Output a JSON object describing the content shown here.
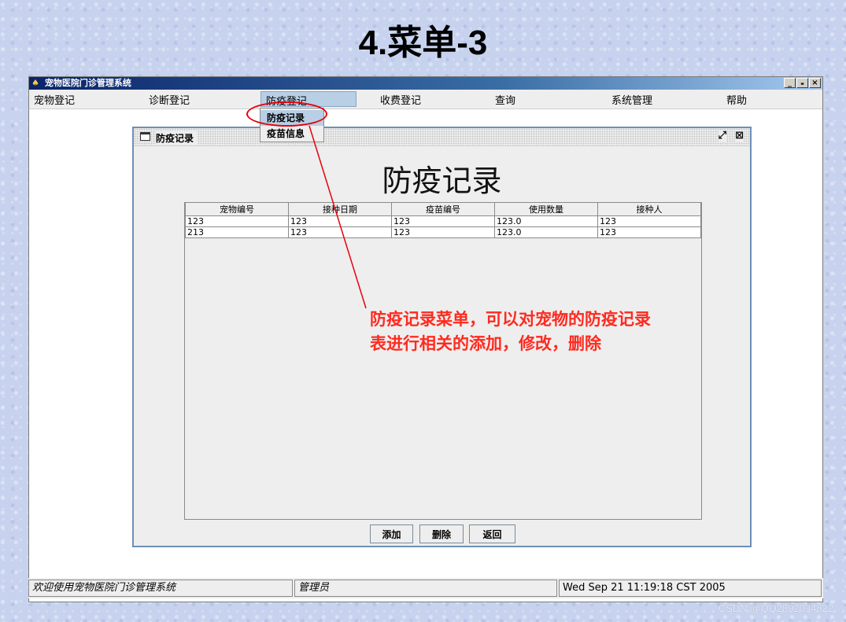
{
  "slide": {
    "title": "4.菜单-3"
  },
  "window": {
    "title": "宠物医院门诊管理系统",
    "icon": "app-icon",
    "controls": [
      "_",
      "ₔ",
      "×"
    ]
  },
  "menu": {
    "items": [
      "宠物登记",
      "诊断登记",
      "防疫登记",
      "收费登记",
      "查询",
      "系统管理",
      "帮助"
    ],
    "active": "防疫登记",
    "dropdown": [
      "防疫记录",
      "疫苗信息"
    ],
    "selected": "防疫记录"
  },
  "frame": {
    "title": "防疫记录",
    "heading": "防疫记录",
    "controls": [
      "restore-icon",
      "close-icon"
    ]
  },
  "table": {
    "columns": [
      "宠物编号",
      "接种日期",
      "疫苗编号",
      "使用数量",
      "接种人"
    ],
    "rows": [
      [
        "123",
        "123",
        "123",
        "123.0",
        "123"
      ],
      [
        "213",
        "123",
        "123",
        "123.0",
        "123"
      ]
    ]
  },
  "buttons": {
    "add": "添加",
    "delete": "删除",
    "back": "返回"
  },
  "annotation": {
    "line1": "防疫记录菜单，可以对宠物的防疫记录",
    "line2": "表进行相关的添加，修改，删除",
    "color": "#ff2a1f"
  },
  "status": {
    "welcome": "欢迎使用宠物医院门诊管理系统",
    "user": "管理员",
    "time": "Wed Sep 21 11:19:18 CST 2005"
  },
  "watermark": "CSDN @QQ2892034822"
}
